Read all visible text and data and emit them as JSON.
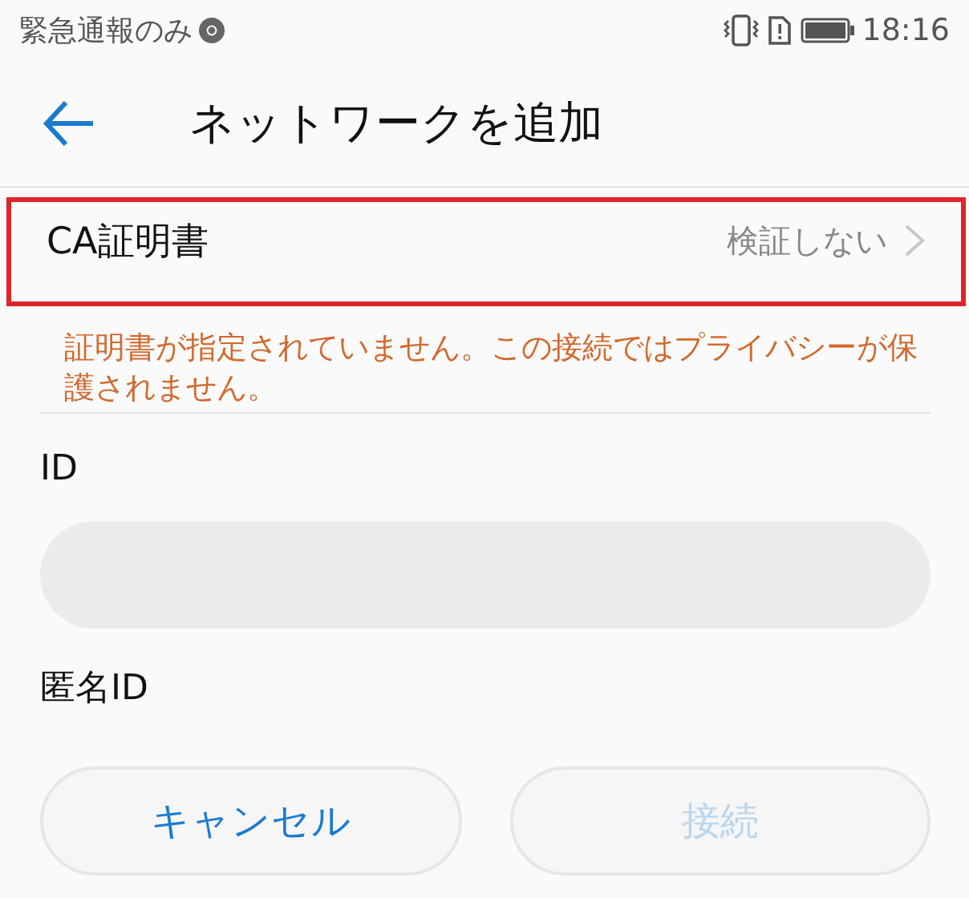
{
  "status_bar": {
    "carrier": "緊急通報のみ",
    "time": "18:16"
  },
  "toolbar": {
    "title": "ネットワークを追加"
  },
  "ca_certificate": {
    "label": "CA証明書",
    "value": "検証しない",
    "highlighted": true
  },
  "warning": "証明書が指定されていません。この接続ではプライバシーが保護されません。",
  "fields": [
    {
      "label": "ID"
    },
    {
      "label": "匿名ID"
    }
  ],
  "buttons": [
    {
      "label": "キャンセル",
      "disabled": false
    },
    {
      "label": "接続",
      "disabled": true
    }
  ]
}
